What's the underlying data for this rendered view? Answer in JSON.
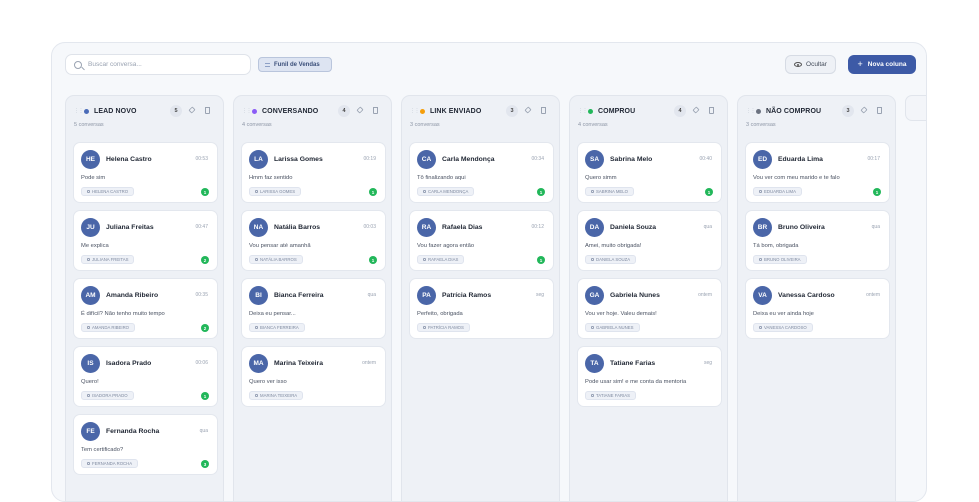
{
  "toolbar": {
    "search_placeholder": "Buscar conversa...",
    "funnel_label": "Funil de Vendas",
    "hide_label": "Ocultar",
    "new_column_label": "Nova coluna"
  },
  "columns": [
    {
      "title": "LEAD NOVO",
      "color": "#4a6bb8",
      "count": "5",
      "subtitle": "5 conversas",
      "cards": [
        {
          "initials": "HE",
          "name": "Helena Castro",
          "time": "00:53",
          "message": "Pode sim",
          "tag": "HELENA CASTRO",
          "unread": "1"
        },
        {
          "initials": "JU",
          "name": "Juliana Freitas",
          "time": "00:47",
          "message": "Me explica",
          "tag": "JULIANA FREITAS",
          "unread": "2"
        },
        {
          "initials": "AM",
          "name": "Amanda Ribeiro",
          "time": "00:35",
          "message": "É difícil? Não tenho muito tempo",
          "tag": "AMANDA RIBEIRO",
          "unread": "2"
        },
        {
          "initials": "IS",
          "name": "Isadora Prado",
          "time": "00:06",
          "message": "Quero!",
          "tag": "ISADORA PRADO",
          "unread": "1"
        },
        {
          "initials": "FE",
          "name": "Fernanda Rocha",
          "time": "qua",
          "message": "Tem certificado?",
          "tag": "FERNANDA ROCHA",
          "unread": "3"
        }
      ]
    },
    {
      "title": "CONVERSANDO",
      "color": "#8b5cf6",
      "count": "4",
      "subtitle": "4 conversas",
      "cards": [
        {
          "initials": "LA",
          "name": "Larissa Gomes",
          "time": "00:19",
          "message": "Hmm faz sentido",
          "tag": "LARISSA GOMES",
          "unread": "1"
        },
        {
          "initials": "NA",
          "name": "Natália Barros",
          "time": "00:03",
          "message": "Vou pensar até amanhã",
          "tag": "NATÁLIA BARROS",
          "unread": "1"
        },
        {
          "initials": "BI",
          "name": "Bianca Ferreira",
          "time": "qua",
          "message": "Deixa eu pensar...",
          "tag": "BIANCA FERREIRA",
          "unread": ""
        },
        {
          "initials": "MA",
          "name": "Marina Teixeira",
          "time": "ontem",
          "message": "Quero ver isso",
          "tag": "MARINA TEIXEIRA",
          "unread": ""
        }
      ]
    },
    {
      "title": "LINK ENVIADO",
      "color": "#f59e0b",
      "count": "3",
      "subtitle": "3 conversas",
      "cards": [
        {
          "initials": "CA",
          "name": "Carla Mendonça",
          "time": "00:34",
          "message": "Tô finalizando aqui",
          "tag": "CARLA MENDONÇA",
          "unread": "1"
        },
        {
          "initials": "RA",
          "name": "Rafaela Dias",
          "time": "00:12",
          "message": "Vou fazer agora então",
          "tag": "RAFAELA DIAS",
          "unread": "1"
        },
        {
          "initials": "PA",
          "name": "Patrícia Ramos",
          "time": "seg",
          "message": "Perfeito, obrigada",
          "tag": "PATRÍCIA RAMOS",
          "unread": ""
        }
      ]
    },
    {
      "title": "COMPROU",
      "color": "#22b75a",
      "count": "4",
      "subtitle": "4 conversas",
      "cards": [
        {
          "initials": "SA",
          "name": "Sabrina Melo",
          "time": "00:40",
          "message": "Quero simm",
          "tag": "SABRINA MELO",
          "unread": "1"
        },
        {
          "initials": "DA",
          "name": "Daniela Souza",
          "time": "qua",
          "message": "Amei, muito obrigada!",
          "tag": "DANIELA SOUZA",
          "unread": ""
        },
        {
          "initials": "GA",
          "name": "Gabriela Nunes",
          "time": "ontem",
          "message": "Vou ver hoje. Valeu demais!",
          "tag": "GABRIELA NUNES",
          "unread": ""
        },
        {
          "initials": "TA",
          "name": "Tatiane Farias",
          "time": "seg",
          "message": "Pode usar sim! e me conta da mentoria",
          "tag": "TATIANE FARIAS",
          "unread": ""
        }
      ]
    },
    {
      "title": "NÃO COMPROU",
      "color": "#6b7280",
      "count": "3",
      "subtitle": "3 conversas",
      "cards": [
        {
          "initials": "ED",
          "name": "Eduarda Lima",
          "time": "00:17",
          "message": "Vou ver com meu marido e te falo",
          "tag": "EDUARDA LIMA",
          "unread": "1"
        },
        {
          "initials": "BR",
          "name": "Bruno Oliveira",
          "time": "qua",
          "message": "Tá bom, obrigada",
          "tag": "BRUNO OLIVEIRA",
          "unread": ""
        },
        {
          "initials": "VA",
          "name": "Vanessa Cardoso",
          "time": "ontem",
          "message": "Deixa eu ver ainda hoje",
          "tag": "VANESSA CARDOSO",
          "unread": ""
        }
      ]
    }
  ]
}
